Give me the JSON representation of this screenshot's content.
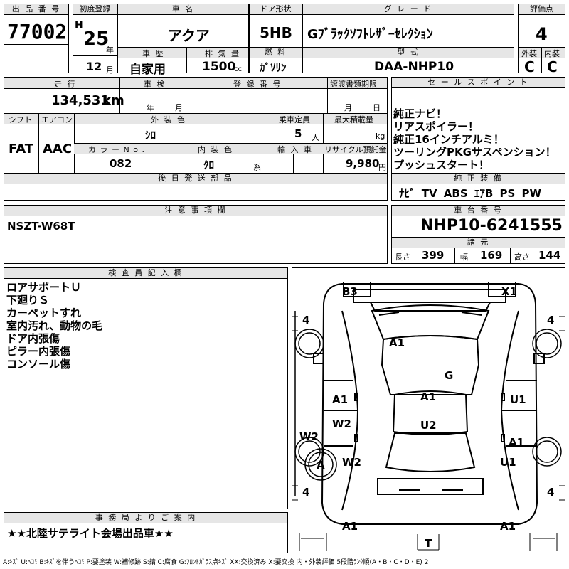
{
  "hdr": {
    "lot_no": "出 品 番 号",
    "first_reg": "初度登録",
    "car_name": "車 名",
    "door": "ドア形状",
    "grade": "グ レ ー ド",
    "score": "評価点",
    "history": "車 歴",
    "displacement": "排 気 量",
    "fuel": "燃 料",
    "model": "型 式",
    "ext": "外装",
    "int": "内装",
    "mileage": "走 行",
    "inspection": "車 検",
    "reg_no": "登 録 番 号",
    "transfer": "譲渡書類期限",
    "sales": "セ ー ル ス ポ イ ン ト",
    "shift": "シフト",
    "ac": "エアコン",
    "ext_color": "外 装 色",
    "capacity": "乗車定員",
    "max_load": "最大積載量",
    "color_no": "カ ラ ー N o .",
    "int_color": "内 装 色",
    "import": "輸 入 車",
    "recycle": "リサイクル預託金",
    "later_parts": "後 日 発 送 部 品",
    "equipment": "純 正 装 備",
    "notes": "注 意 事 項 欄",
    "chassis": "車 台 番 号",
    "dims": "諸 元",
    "inspector": "検 査 員 記 入 欄",
    "office": "事 務 局 よ り ご 案 内"
  },
  "units": {
    "year": "年",
    "month": "月",
    "cc": "cc",
    "km": "km",
    "y": "年",
    "m": "月",
    "tm": "月",
    "d": "日",
    "person": "人",
    "kg": "kg",
    "kei": "系",
    "yen": "円",
    "length": "長さ",
    "width": "幅",
    "height": "高さ",
    "H": "H"
  },
  "values": {
    "lot_no": "77002",
    "era_year": "25",
    "reg_month": "12",
    "car_name": "アクア",
    "door": "5HB",
    "grade": "Gﾌﾞﾗｯｸｿﾌﾄﾚｻﾞｰｾﾚｸｼｮﾝ",
    "score": "4",
    "history": "自家用",
    "displacement": "1500",
    "fuel": "ｶﾞｿﾘﾝ",
    "model": "DAA-NHP10",
    "ext": "C",
    "int": "C",
    "mileage": "134,531",
    "shift": "FAT",
    "ac": "AAC",
    "ext_color": "ｼﾛ",
    "capacity": "5",
    "color_no": "082",
    "int_color": "ｸﾛ",
    "recycle": "9,980",
    "equipment": "ﾅﾋﾞ TV ABS ｴｱB PS PW",
    "notes": "NSZT-W68T",
    "chassis": "NHP10-6241555",
    "length": "399",
    "width": "169",
    "height": "144",
    "office": "★★北陸サテライト会場出品車★★"
  },
  "sales_points": [
    "純正ナビ！",
    "リアスポイラー！",
    "純正16インチアルミ！",
    "ツーリングPKGサスペンション！",
    "プッシュスタート！"
  ],
  "inspector_notes": [
    "ロアサポートＵ",
    "下廻りＳ",
    "カーペットすれ",
    "室内汚れ、動物の毛",
    "ドア内張傷",
    "ピラー内張傷",
    "コンソール傷"
  ],
  "diagram": {
    "B3": "B3",
    "X1": "X1",
    "A1_roof": "A1",
    "G": "G",
    "A1_lf": "A1",
    "A1_c": "A1",
    "U1_rf": "U1",
    "W2_ld": "W2",
    "U2": "U2",
    "W2_lwheel": "W2",
    "A1_rr": "A1",
    "A_spare": "A",
    "W2_lr": "W2",
    "U1_rr": "U1",
    "A1_bl": "A1",
    "A1_br": "A1",
    "T": "T",
    "tread_tl": "4",
    "tread_tr": "4",
    "tread_bl": "4",
    "tread_br": "4"
  },
  "legend": "A:ｷｽﾞ U:ﾍｺﾐ B:ｷｽﾞを伴うﾍｺﾐ P:要塗装 W:補修跡 S:錆 C:腐食 G:ﾌﾛﾝﾄｶﾞﾗｽ点ｷｽﾞ XX:交換済み X:要交換 内・外装評価 5段階ﾗﾝｸ順(A・B・C・D・E) 2"
}
